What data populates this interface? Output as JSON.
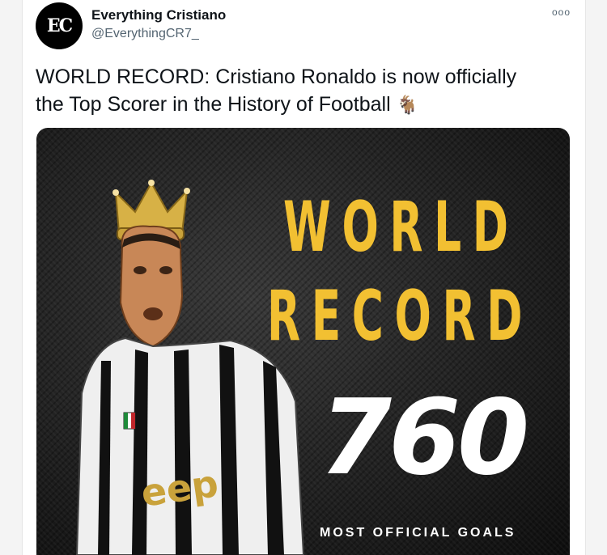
{
  "account": {
    "name": "Everything Cristiano",
    "handle": "@EverythingCR7_",
    "avatar_mark": "EC"
  },
  "tweet": {
    "text_line1": "WORLD RECORD: Cristiano Ronaldo is now officially",
    "text_line2": "the Top Scorer in the History of Football",
    "emoji": "🐐"
  },
  "menu": {
    "more_label": "ooo"
  },
  "media": {
    "headline_line1": "WORLD",
    "headline_line2": "RECORD",
    "goals": "760",
    "caption": "MOST OFFICIAL GOALS",
    "shirt_sponsor": "eep"
  },
  "colors": {
    "headline": "#f2c032",
    "count": "#ffffff",
    "background": "#1b1b1b"
  },
  "icons": {
    "more": "more-horizontal-icon",
    "emoji": "goat-emoji"
  }
}
